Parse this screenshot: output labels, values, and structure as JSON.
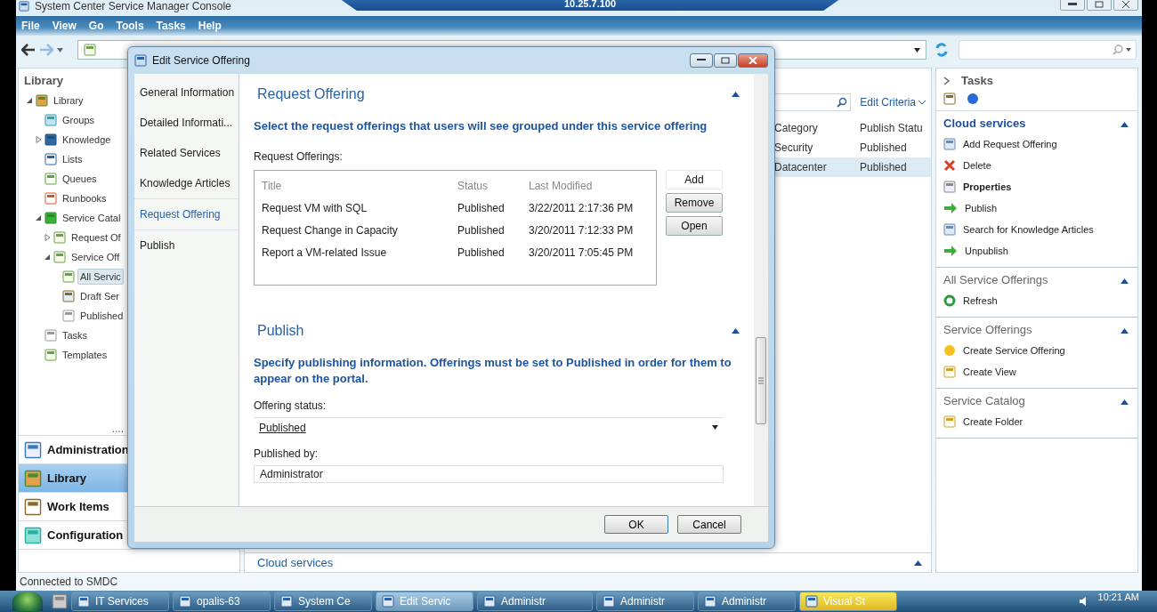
{
  "window": {
    "title": "System Center Service Manager Console",
    "remote_session": "10.25.7.100"
  },
  "menu": [
    "File",
    "View",
    "Go",
    "Tools",
    "Tasks",
    "Help"
  ],
  "navigation": {
    "title": "Library",
    "tree": [
      {
        "label": "Library",
        "expanded": true,
        "children": [
          {
            "label": "Groups"
          },
          {
            "label": "Knowledge",
            "expanded": false
          },
          {
            "label": "Lists"
          },
          {
            "label": "Queues"
          },
          {
            "label": "Runbooks"
          },
          {
            "label": "Service Catal",
            "expanded": true,
            "children": [
              {
                "label": "Request Of",
                "expanded": false
              },
              {
                "label": "Service Off",
                "expanded": true,
                "children": [
                  {
                    "label": "All Servic",
                    "selected": true
                  },
                  {
                    "label": "Draft Ser",
                    "selected": false
                  },
                  {
                    "label": "Published",
                    "selected": false
                  }
                ]
              }
            ]
          },
          {
            "label": "Tasks"
          },
          {
            "label": "Templates"
          }
        ]
      }
    ],
    "more": "....",
    "workspaces": [
      {
        "label": "Administration",
        "selected": false
      },
      {
        "label": "Library",
        "selected": true
      },
      {
        "label": "Work Items",
        "selected": false
      },
      {
        "label": "Configuration",
        "selected": false
      }
    ]
  },
  "list_view": {
    "filter_button": "Edit Criteria",
    "columns": [
      "Category",
      "Publish Statu"
    ],
    "rows": [
      {
        "cells": [
          "Security",
          "Published"
        ],
        "selected": false
      },
      {
        "cells": [
          "Datacenter",
          "Published"
        ],
        "selected": true
      }
    ],
    "details_bar": "Cloud services"
  },
  "tasks_pane": {
    "title": "Tasks",
    "sections": [
      {
        "title": "Cloud services",
        "expanded": true,
        "items": [
          {
            "label": "Add Request Offering",
            "bold": false
          },
          {
            "label": "Delete",
            "bold": false
          },
          {
            "label": "Properties",
            "bold": true
          },
          {
            "label": "Publish",
            "bold": false
          },
          {
            "label": "Search for Knowledge Articles",
            "bold": false
          },
          {
            "label": "Unpublish",
            "bold": false
          }
        ]
      },
      {
        "title": "All Service Offerings",
        "expanded": true,
        "items": [
          {
            "label": "Refresh",
            "bold": false
          }
        ]
      },
      {
        "title": "Service Offerings",
        "expanded": true,
        "items": [
          {
            "label": "Create Service Offering",
            "bold": false
          },
          {
            "label": "Create View",
            "bold": false
          }
        ]
      },
      {
        "title": "Service Catalog",
        "expanded": true,
        "items": [
          {
            "label": "Create Folder",
            "bold": false
          }
        ]
      }
    ]
  },
  "status_bar": "Connected to SMDC",
  "dialog": {
    "title": "Edit Service Offering",
    "pages": [
      {
        "label": "General Information",
        "selected": false
      },
      {
        "label": "Detailed Informati...",
        "selected": false
      },
      {
        "label": "Related Services",
        "selected": false
      },
      {
        "label": "Knowledge Articles",
        "selected": false
      },
      {
        "label": "Request Offering",
        "selected": true
      },
      {
        "label": "Publish",
        "selected": false
      }
    ],
    "request_offering": {
      "heading": "Request Offering",
      "instruction": "Select the request offerings that users will see grouped under this service offering",
      "list_label": "Request Offerings:",
      "columns": [
        "Title",
        "Status",
        "Last Modified"
      ],
      "rows": [
        [
          "Request VM with SQL",
          "Published",
          "3/22/2011 2:17:36 PM"
        ],
        [
          "Request Change in Capacity",
          "Published",
          "3/20/2011 7:12:33 PM"
        ],
        [
          "Report a VM-related Issue",
          "Published",
          "3/20/2011 7:05:45 PM"
        ]
      ],
      "buttons": [
        {
          "label": "Add",
          "disabled": true
        },
        {
          "label": "Remove",
          "disabled": false
        },
        {
          "label": "Open",
          "disabled": false
        }
      ]
    },
    "publish": {
      "heading": "Publish",
      "instruction": "Specify publishing information.  Offerings must be set to Published in order for them to appear on the portal.",
      "status_label": "Offering status:",
      "status_value": "Published",
      "published_by_label": "Published by:",
      "published_by_value": "Administrator"
    },
    "buttons": [
      "OK",
      "Cancel"
    ]
  },
  "taskbar": {
    "items": [
      {
        "label": "IT Services",
        "active": false
      },
      {
        "label": "opalis-63",
        "active": false
      },
      {
        "label": "System Ce",
        "active": false
      },
      {
        "label": "Edit Servic",
        "active": true
      },
      {
        "label": "Administr",
        "active": false
      },
      {
        "label": "Administr",
        "active": false
      },
      {
        "label": "Administr",
        "active": false
      },
      {
        "label": "Visual St",
        "active": false
      }
    ],
    "clock": "10:21 AM"
  }
}
